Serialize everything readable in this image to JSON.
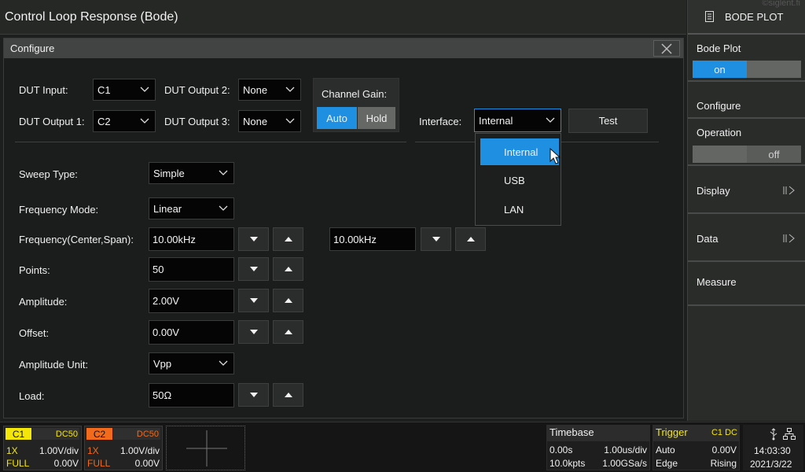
{
  "app": {
    "title": "Control Loop Response (Bode)",
    "watermark": "©siglent.fi"
  },
  "right_panel": {
    "header_label": "BODE PLOT",
    "header_icon": "document-list-icon",
    "bode_plot": {
      "label": "Bode Plot",
      "on_label": "on",
      "state": "on"
    },
    "configure_label": "Configure",
    "operation": {
      "label": "Operation",
      "off_label": "off",
      "state": "off"
    },
    "display_label": "Display",
    "data_label": "Data",
    "measure_label": "Measure",
    "expand_icon": "expand-arrow-icon"
  },
  "configure": {
    "title": "Configure",
    "close_icon": "close-icon",
    "dut_input": {
      "label": "DUT Input:",
      "value": "C1"
    },
    "dut_output1": {
      "label": "DUT Output 1:",
      "value": "C2"
    },
    "dut_output2": {
      "label": "DUT Output 2:",
      "value": "None"
    },
    "dut_output3": {
      "label": "DUT Output 3:",
      "value": "None"
    },
    "channel_gain": {
      "label": "Channel Gain:",
      "auto": "Auto",
      "hold": "Hold",
      "selected": "Auto"
    },
    "interface": {
      "label": "Interface:",
      "value": "Internal",
      "options": [
        "Internal",
        "USB",
        "LAN"
      ],
      "test_label": "Test"
    },
    "sweep_type": {
      "label": "Sweep Type:",
      "value": "Simple"
    },
    "frequency_mode": {
      "label": "Frequency Mode:",
      "value": "Linear"
    },
    "frequency": {
      "label": "Frequency(Center,Span):",
      "center": "10.00kHz",
      "span": "10.00kHz"
    },
    "points": {
      "label": "Points:",
      "value": "50"
    },
    "amplitude": {
      "label": "Amplitude:",
      "value": "2.00V"
    },
    "offset": {
      "label": "Offset:",
      "value": "0.00V"
    },
    "amplitude_unit": {
      "label": "Amplitude Unit:",
      "value": "Vpp"
    },
    "load": {
      "label": "Load:",
      "value": "50Ω"
    }
  },
  "status_bar": {
    "c1": {
      "tag": "C1",
      "coupling": "DC50",
      "probe": "1X",
      "scale": "1.00V/div",
      "bw": "FULL",
      "offset": "0.00V",
      "color": "#f5e60a"
    },
    "c2": {
      "tag": "C2",
      "coupling": "DC50",
      "probe": "1X",
      "scale": "1.00V/div",
      "bw": "FULL",
      "offset": "0.00V",
      "color": "#f26a1b"
    },
    "add_channel_icon": "plus-icon",
    "timebase": {
      "title": "Timebase",
      "delay": "0.00s",
      "scale": "1.00us/div",
      "points": "10.0kpts",
      "rate": "1.00GSa/s"
    },
    "trigger": {
      "title": "Trigger",
      "source": "C1 DC",
      "mode": "Auto",
      "level": "0.00V",
      "type": "Edge",
      "slope": "Rising"
    },
    "system": {
      "usb_icon": "usb-icon",
      "network_icon": "network-icon",
      "time": "14:03:30",
      "date": "2021/3/22"
    }
  },
  "colors": {
    "accent_blue": "#1f8fe2",
    "c1_yellow": "#f5e60a",
    "c2_orange": "#f26a1b",
    "trigger_yellow": "#f5e60a"
  }
}
